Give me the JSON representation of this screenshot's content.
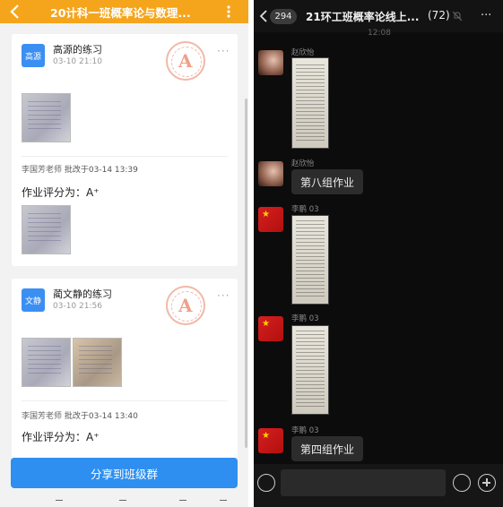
{
  "left": {
    "header": {
      "title": "20计科一班概率论与数理..."
    },
    "cards": [
      {
        "avatar_text": "高源",
        "name": "高源的练习",
        "date": "03-10 21:10",
        "reviewer": "李国芳老师",
        "review_text": "批改于03-14 13:39",
        "grade": "作业评分为：A⁺"
      },
      {
        "avatar_text": "文静",
        "name": "蔺文静的练习",
        "date": "03-10 21:56",
        "reviewer": "李国芳老师",
        "review_text": "批改于03-14 13:40",
        "grade": "作业评分为：A⁺"
      }
    ],
    "more_glyph": "···",
    "share_button": "分享到班级群",
    "stamp_letter": "A"
  },
  "right": {
    "header": {
      "badge": "294",
      "title": "21环工班概率论线上...",
      "member_count": "(72)"
    },
    "time": "12:08",
    "messages": [
      {
        "sender": "赵欣怡",
        "type": "image"
      },
      {
        "sender": "赵欣怡",
        "type": "text",
        "text": "第八组作业"
      },
      {
        "sender": "李鹏 03",
        "type": "image"
      },
      {
        "sender": "李鹏 03",
        "type": "image"
      },
      {
        "sender": "李鹏 03",
        "type": "text",
        "text": "第四组作业"
      }
    ]
  },
  "colors": {
    "orange_header": "#f5a51c",
    "blue_accent": "#2e8ff0",
    "dark_bg": "#0c0c0c"
  }
}
